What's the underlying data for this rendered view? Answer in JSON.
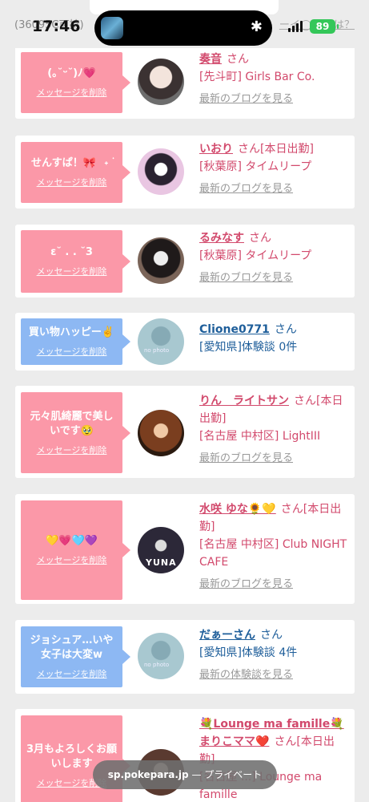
{
  "status": {
    "time": "17:46",
    "battery": "89",
    "behind_left": "(36095C可持)",
    "behind_right": "ーイ◯◯とは？",
    "icons": [
      "app-thumb-icon",
      "bluetooth-icon",
      "signal-icon",
      "battery-icon"
    ]
  },
  "colors": {
    "pink_bubble": "#fb98a8",
    "blue_bubble": "#8db8f3",
    "name_pink": "#d2496c",
    "name_blue": "#1e5e9a"
  },
  "cards": [
    {
      "bubble_text": "(｡˘ᵕ˘)ﾉ💗",
      "delete_label": "メッセージを削除",
      "name": "奏音",
      "san": "さん",
      "shop": "[先斗町] Girls Bar Co.",
      "blog_label": "最新のブログを見る"
    },
    {
      "bubble_text": "せんすぱ！🎀⠀˖ ࣪",
      "delete_label": "メッセージを削除",
      "name": "いおり",
      "san": "さん[本日出勤]",
      "shop": "[秋葉原] タイムリープ",
      "blog_label": "最新のブログを見る"
    },
    {
      "bubble_text": "ε˘ . . ˘3",
      "delete_label": "メッセージを削除",
      "name": "るみなす",
      "san": "さん",
      "shop": "[秋葉原] タイムリープ",
      "blog_label": "最新のブログを見る"
    },
    {
      "bubble_text": "買い物ハッピー✌️",
      "delete_label": "メッセージを削除",
      "name": "Clione0771",
      "san": "さん",
      "shop": "[愛知県]体験談 0件",
      "blog_label": "",
      "avatar_text": "no photo"
    },
    {
      "bubble_text": "元々肌綺麗で美しいです🥹",
      "delete_label": "メッセージを削除",
      "name": "りん　ライトサン",
      "san": "さん[本日出勤]",
      "shop": "[名古屋 中村区] LightIII",
      "blog_label": "最新のブログを見る"
    },
    {
      "bubble_text": "💛💗🩵💜",
      "delete_label": "メッセージを削除",
      "name": "水咲 ゆな🌻💛",
      "san": "さん[本日出勤]",
      "shop": "[名古屋 中村区] Club NIGHT CAFE",
      "blog_label": "最新のブログを見る",
      "avatar_text": "YUNA"
    },
    {
      "bubble_text": "ジョシュア…いや女子は大変w",
      "delete_label": "メッセージを削除",
      "name": "だぁーさん",
      "san": "さん",
      "shop": "[愛知県]体験談 4件",
      "blog_label": "最新の体験談を見る",
      "avatar_text": "no photo"
    },
    {
      "bubble_text": "3月もよろしくお願いします",
      "delete_label": "メッセージを削除",
      "name": "💐Lounge ma famille💐まりこママ❤️",
      "san": "さん[本日出勤]",
      "shop": "[名古屋 ...] Lounge ma famille",
      "blog_label": ""
    }
  ],
  "urlbar": {
    "domain": "sp.pokepara.jp",
    "suffix": "— プライベート"
  }
}
